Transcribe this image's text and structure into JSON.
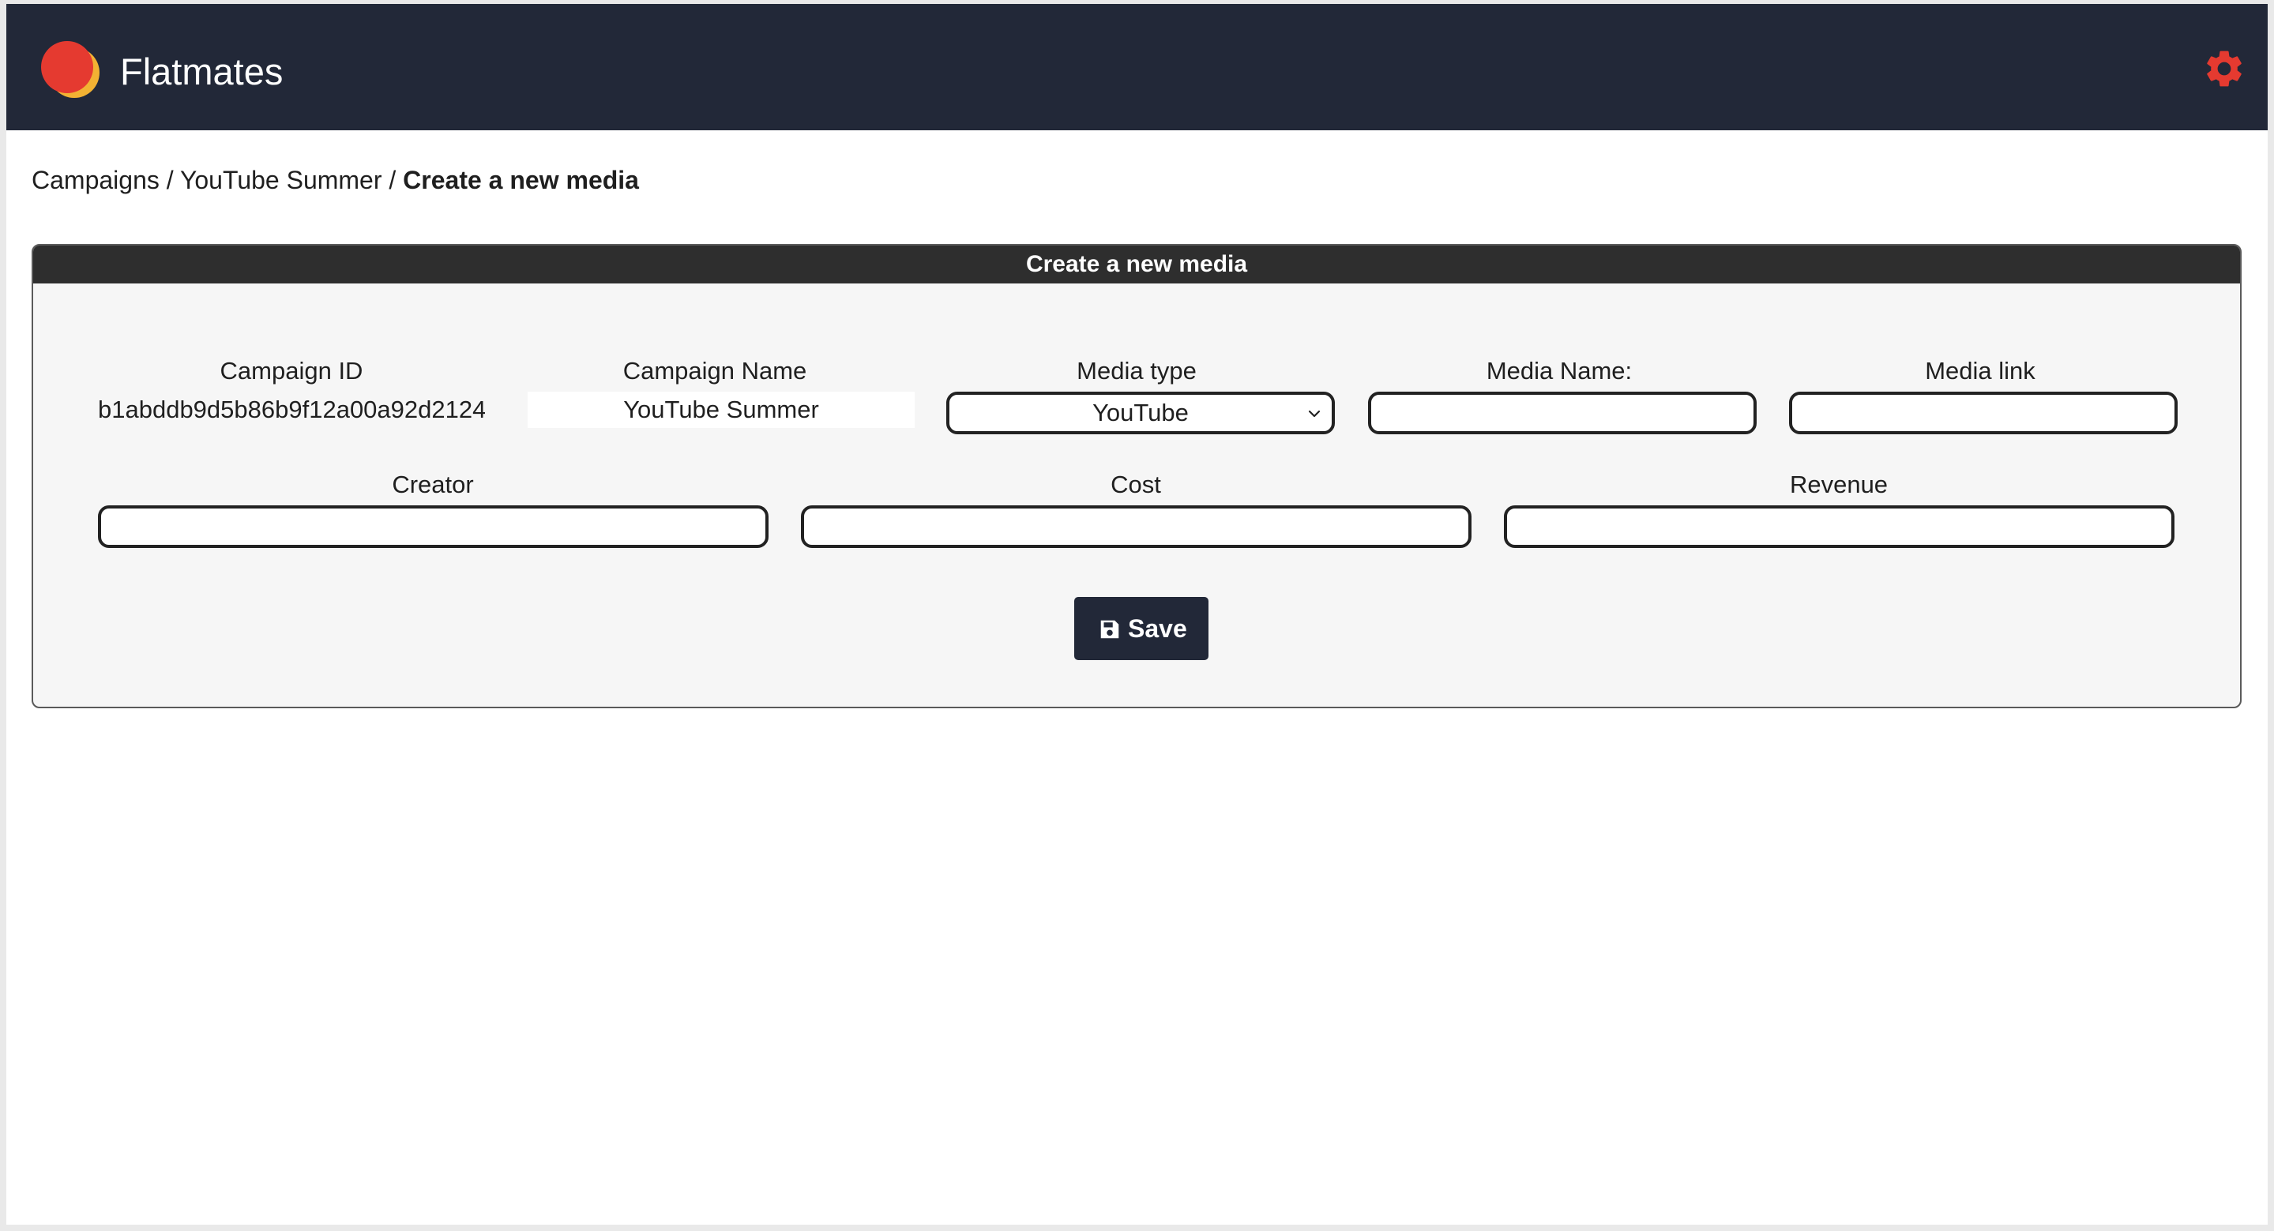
{
  "app": {
    "title": "Flatmates",
    "settings_icon": "gear-icon",
    "accent_color": "#e53a30",
    "header_color": "#222838"
  },
  "breadcrumb": {
    "items": [
      "Campaigns",
      "YouTube Summer",
      "Create a new media"
    ],
    "separator": "/"
  },
  "card": {
    "title": "Create a new media"
  },
  "form": {
    "campaign_id": {
      "label": "Campaign ID",
      "value": "b1abddb9d5b86b9f12a00a92d2124"
    },
    "campaign_name": {
      "label": "Campaign Name",
      "value": "YouTube Summer"
    },
    "media_type": {
      "label": "Media type",
      "value": "YouTube"
    },
    "media_name": {
      "label": "Media Name:",
      "value": ""
    },
    "media_link": {
      "label": "Media link",
      "value": ""
    },
    "creator": {
      "label": "Creator",
      "value": ""
    },
    "cost": {
      "label": "Cost",
      "value": ""
    },
    "revenue": {
      "label": "Revenue",
      "value": ""
    }
  },
  "actions": {
    "save_label": "Save",
    "save_icon": "floppy-disk-icon"
  }
}
